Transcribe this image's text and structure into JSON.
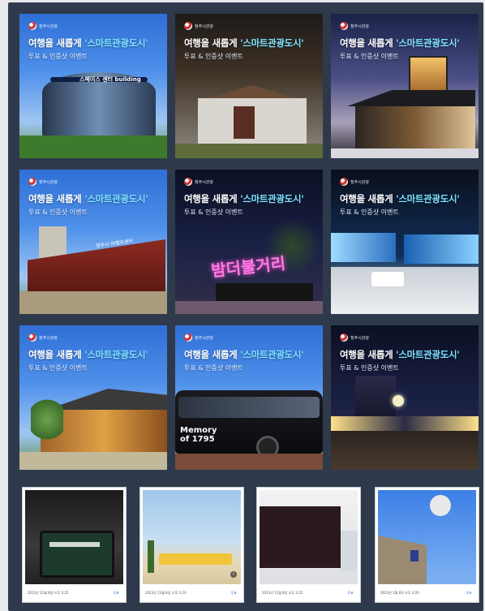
{
  "banner": {
    "brand": "청주시관광",
    "headline_prefix": "여행을 새롭게 ",
    "headline_highlight": "'스마트관광도시'",
    "subline": "투표 & 인증샷 이벤트"
  },
  "tiles": [
    {
      "id": 1,
      "scene": "스페이스 센터 building"
    },
    {
      "id": 2,
      "scene": "historic house"
    },
    {
      "id": 3,
      "scene": "glass pavilion night"
    },
    {
      "id": 4,
      "scene": "청주시 여행자센터",
      "sign": "청주시 여행자센터"
    },
    {
      "id": 5,
      "scene": "neon sign",
      "sign": "밤더불거리"
    },
    {
      "id": 6,
      "scene": "media art hall"
    },
    {
      "id": 7,
      "scene": "hanok pavilion"
    },
    {
      "id": 8,
      "scene": "tour bus",
      "sign": "Memory of 1795"
    },
    {
      "id": 9,
      "scene": "night lake"
    }
  ],
  "cards": [
    {
      "date": "2023년 12월 8일 오후 3:25",
      "action": "투표"
    },
    {
      "date": "2023년 12월 8일 오후 3:23",
      "action": "투표"
    },
    {
      "date": "2023년 12월 8일 오후 3:22",
      "action": "투표"
    },
    {
      "date": "2023년 1월 8일 오후 3:20",
      "action": "투표"
    }
  ],
  "colors": {
    "frame": "#2e3a4c",
    "highlight": "#7ee3ff",
    "action": "#3a6fe0"
  }
}
